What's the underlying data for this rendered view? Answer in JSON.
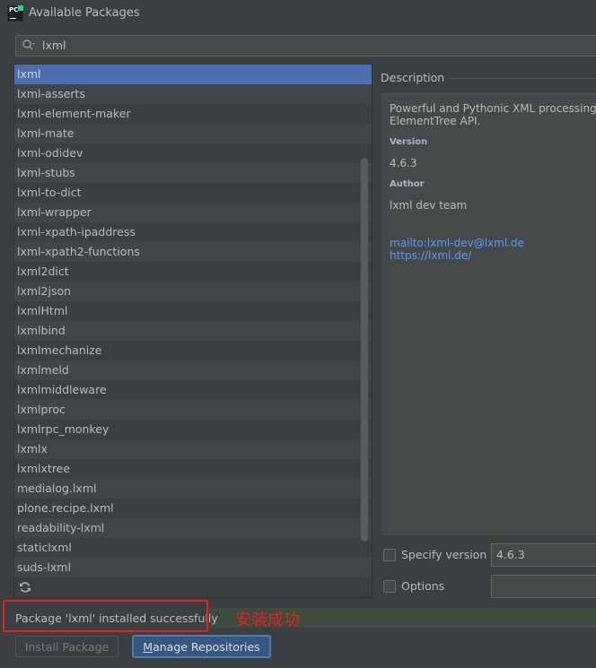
{
  "window": {
    "title": "Available Packages"
  },
  "search": {
    "query": "lxml"
  },
  "packages": [
    "lxml",
    "lxml-asserts",
    "lxml-element-maker",
    "lxml-mate",
    "lxml-odidev",
    "lxml-stubs",
    "lxml-to-dict",
    "lxml-wrapper",
    "lxml-xpath-ipaddress",
    "lxml-xpath2-functions",
    "lxml2dict",
    "lxml2json",
    "lxmlHtml",
    "lxmlbind",
    "lxmlmechanize",
    "lxmlmeld",
    "lxmlmiddleware",
    "lxmlproc",
    "lxmlrpc_monkey",
    "lxmlx",
    "lxmlxtree",
    "medialog.lxml",
    "plone.recipe.lxml",
    "readability-lxml",
    "staticlxml",
    "suds-lxml"
  ],
  "selected_index": 0,
  "description": {
    "header": "Description",
    "summary_line1": "Powerful and Pythonic XML processing libr",
    "summary_line2": "ElementTree API.",
    "version_label": "Version",
    "version": "4.6.3",
    "author_label": "Author",
    "author": "lxml dev team",
    "mail_link": "mailto:lxml-dev@lxml.de",
    "home_link": "https://lxml.de/"
  },
  "options": {
    "specify_version_label": "Specify version",
    "specify_version_value": "4.6.3",
    "options_label": "Options"
  },
  "status": {
    "message": "Package 'lxml' installed successfully",
    "annotation": "安装成功"
  },
  "buttons": {
    "install": "Install Package",
    "manage": "Manage Repositories"
  },
  "icons": {
    "app": "pycharm-logo",
    "search": "search-icon",
    "refresh": "refresh-icon"
  },
  "colors": {
    "background": "#3c3f41",
    "selection": "#4b6eaf",
    "link": "#589df6",
    "highlight_box": "#e02424"
  }
}
